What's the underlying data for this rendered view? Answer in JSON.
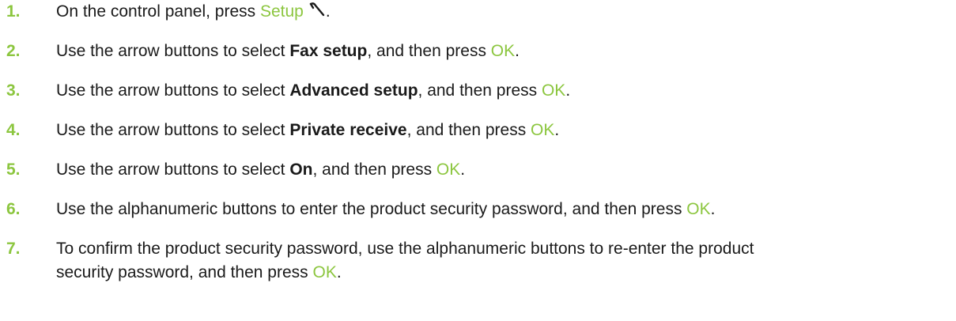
{
  "steps": [
    {
      "number": "1.",
      "text_before": "On the control panel, press ",
      "control": "Setup",
      "icon": "wrench-icon",
      "text_after": "."
    },
    {
      "number": "2.",
      "text_before": "Use the arrow buttons to select ",
      "keyword": "Fax setup",
      "text_middle": ", and then press ",
      "control": "OK",
      "text_after": "."
    },
    {
      "number": "3.",
      "text_before": "Use the arrow buttons to select ",
      "keyword": "Advanced setup",
      "text_middle": ", and then press ",
      "control": "OK",
      "text_after": "."
    },
    {
      "number": "4.",
      "text_before": "Use the arrow buttons to select ",
      "keyword": "Private receive",
      "text_middle": ", and then press ",
      "control": "OK",
      "text_after": "."
    },
    {
      "number": "5.",
      "text_before": "Use the arrow buttons to select ",
      "keyword": "On",
      "text_middle": ", and then press ",
      "control": "OK",
      "text_after": "."
    },
    {
      "number": "6.",
      "text_before": "Use the alphanumeric buttons to enter the product security password, and then press ",
      "control": "OK",
      "text_after": "."
    },
    {
      "number": "7.",
      "text_line1": "To confirm the product security password, use the alphanumeric buttons to re-enter the product",
      "text_line2_before": "security password, and then press ",
      "control": "OK",
      "text_after": "."
    }
  ],
  "colors": {
    "accent": "#8cc63f",
    "text": "#1a1a1a"
  }
}
